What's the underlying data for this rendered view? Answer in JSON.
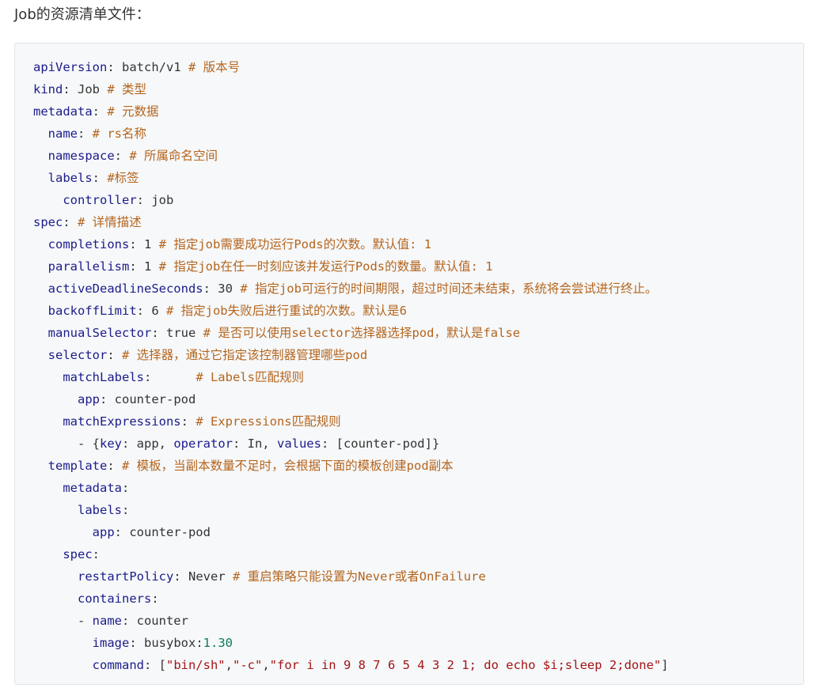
{
  "intro": "Job的资源清单文件：",
  "lines": [
    [
      {
        "t": "",
        "c": "v"
      },
      {
        "t": "apiVersion",
        "c": "k"
      },
      {
        "t": ": batch/v1 ",
        "c": "v"
      },
      {
        "t": "# 版本号",
        "c": "c"
      }
    ],
    [
      {
        "t": "",
        "c": "v"
      },
      {
        "t": "kind",
        "c": "k"
      },
      {
        "t": ": Job ",
        "c": "v"
      },
      {
        "t": "# 类型",
        "c": "c"
      }
    ],
    [
      {
        "t": "",
        "c": "v"
      },
      {
        "t": "metadata",
        "c": "k"
      },
      {
        "t": ": ",
        "c": "v"
      },
      {
        "t": "# 元数据",
        "c": "c"
      }
    ],
    [
      {
        "t": "  ",
        "c": "v"
      },
      {
        "t": "name",
        "c": "k"
      },
      {
        "t": ": ",
        "c": "v"
      },
      {
        "t": "# rs名称",
        "c": "c"
      }
    ],
    [
      {
        "t": "  ",
        "c": "v"
      },
      {
        "t": "namespace",
        "c": "k"
      },
      {
        "t": ": ",
        "c": "v"
      },
      {
        "t": "# 所属命名空间",
        "c": "c"
      }
    ],
    [
      {
        "t": "  ",
        "c": "v"
      },
      {
        "t": "labels",
        "c": "k"
      },
      {
        "t": ": ",
        "c": "v"
      },
      {
        "t": "#标签",
        "c": "c"
      }
    ],
    [
      {
        "t": "    ",
        "c": "v"
      },
      {
        "t": "controller",
        "c": "k"
      },
      {
        "t": ": job",
        "c": "v"
      }
    ],
    [
      {
        "t": "",
        "c": "v"
      },
      {
        "t": "spec",
        "c": "k"
      },
      {
        "t": ": ",
        "c": "v"
      },
      {
        "t": "# 详情描述",
        "c": "c"
      }
    ],
    [
      {
        "t": "  ",
        "c": "v"
      },
      {
        "t": "completions",
        "c": "k"
      },
      {
        "t": ": 1 ",
        "c": "v"
      },
      {
        "t": "# 指定job需要成功运行Pods的次数。默认值: 1",
        "c": "c"
      }
    ],
    [
      {
        "t": "  ",
        "c": "v"
      },
      {
        "t": "parallelism",
        "c": "k"
      },
      {
        "t": ": 1 ",
        "c": "v"
      },
      {
        "t": "# 指定job在任一时刻应该并发运行Pods的数量。默认值: 1",
        "c": "c"
      }
    ],
    [
      {
        "t": "  ",
        "c": "v"
      },
      {
        "t": "activeDeadlineSeconds",
        "c": "k"
      },
      {
        "t": ": 30 ",
        "c": "v"
      },
      {
        "t": "# 指定job可运行的时间期限，超过时间还未结束，系统将会尝试进行终止。",
        "c": "c"
      }
    ],
    [
      {
        "t": "  ",
        "c": "v"
      },
      {
        "t": "backoffLimit",
        "c": "k"
      },
      {
        "t": ": 6 ",
        "c": "v"
      },
      {
        "t": "# 指定job失败后进行重试的次数。默认是6",
        "c": "c"
      }
    ],
    [
      {
        "t": "  ",
        "c": "v"
      },
      {
        "t": "manualSelector",
        "c": "k"
      },
      {
        "t": ": true ",
        "c": "v"
      },
      {
        "t": "# 是否可以使用selector选择器选择pod，默认是false",
        "c": "c"
      }
    ],
    [
      {
        "t": "  ",
        "c": "v"
      },
      {
        "t": "selector",
        "c": "k"
      },
      {
        "t": ": ",
        "c": "v"
      },
      {
        "t": "# 选择器，通过它指定该控制器管理哪些pod",
        "c": "c"
      }
    ],
    [
      {
        "t": "    ",
        "c": "v"
      },
      {
        "t": "matchLabels",
        "c": "k"
      },
      {
        "t": ":      ",
        "c": "v"
      },
      {
        "t": "# Labels匹配规则",
        "c": "c"
      }
    ],
    [
      {
        "t": "      ",
        "c": "v"
      },
      {
        "t": "app",
        "c": "k"
      },
      {
        "t": ": counter-pod",
        "c": "v"
      }
    ],
    [
      {
        "t": "    ",
        "c": "v"
      },
      {
        "t": "matchExpressions",
        "c": "k"
      },
      {
        "t": ": ",
        "c": "v"
      },
      {
        "t": "# Expressions匹配规则",
        "c": "c"
      }
    ],
    [
      {
        "t": "      - {",
        "c": "v"
      },
      {
        "t": "key",
        "c": "k"
      },
      {
        "t": ": app, ",
        "c": "v"
      },
      {
        "t": "operator",
        "c": "k"
      },
      {
        "t": ": In, ",
        "c": "v"
      },
      {
        "t": "values",
        "c": "k"
      },
      {
        "t": ": [counter-pod]}",
        "c": "v"
      }
    ],
    [
      {
        "t": "  ",
        "c": "v"
      },
      {
        "t": "template",
        "c": "k"
      },
      {
        "t": ": ",
        "c": "v"
      },
      {
        "t": "# 模板，当副本数量不足时，会根据下面的模板创建pod副本",
        "c": "c"
      }
    ],
    [
      {
        "t": "    ",
        "c": "v"
      },
      {
        "t": "metadata",
        "c": "k"
      },
      {
        "t": ":",
        "c": "v"
      }
    ],
    [
      {
        "t": "      ",
        "c": "v"
      },
      {
        "t": "labels",
        "c": "k"
      },
      {
        "t": ":",
        "c": "v"
      }
    ],
    [
      {
        "t": "        ",
        "c": "v"
      },
      {
        "t": "app",
        "c": "k"
      },
      {
        "t": ": counter-pod",
        "c": "v"
      }
    ],
    [
      {
        "t": "    ",
        "c": "v"
      },
      {
        "t": "spec",
        "c": "k"
      },
      {
        "t": ":",
        "c": "v"
      }
    ],
    [
      {
        "t": "      ",
        "c": "v"
      },
      {
        "t": "restartPolicy",
        "c": "k"
      },
      {
        "t": ": Never ",
        "c": "v"
      },
      {
        "t": "# 重启策略只能设置为Never或者OnFailure",
        "c": "c"
      }
    ],
    [
      {
        "t": "      ",
        "c": "v"
      },
      {
        "t": "containers",
        "c": "k"
      },
      {
        "t": ":",
        "c": "v"
      }
    ],
    [
      {
        "t": "      - ",
        "c": "v"
      },
      {
        "t": "name",
        "c": "k"
      },
      {
        "t": ": counter",
        "c": "v"
      }
    ],
    [
      {
        "t": "        ",
        "c": "v"
      },
      {
        "t": "image",
        "c": "k"
      },
      {
        "t": ": busybox:",
        "c": "v"
      },
      {
        "t": "1.30",
        "c": "n"
      }
    ],
    [
      {
        "t": "        ",
        "c": "v"
      },
      {
        "t": "command",
        "c": "k"
      },
      {
        "t": ": [",
        "c": "v"
      },
      {
        "t": "\"bin/sh\"",
        "c": "s"
      },
      {
        "t": ",",
        "c": "v"
      },
      {
        "t": "\"-c\"",
        "c": "s"
      },
      {
        "t": ",",
        "c": "v"
      },
      {
        "t": "\"for i in 9 8 7 6 5 4 3 2 1; do echo $i;sleep 2;done\"",
        "c": "s"
      },
      {
        "t": "]",
        "c": "v"
      }
    ]
  ]
}
